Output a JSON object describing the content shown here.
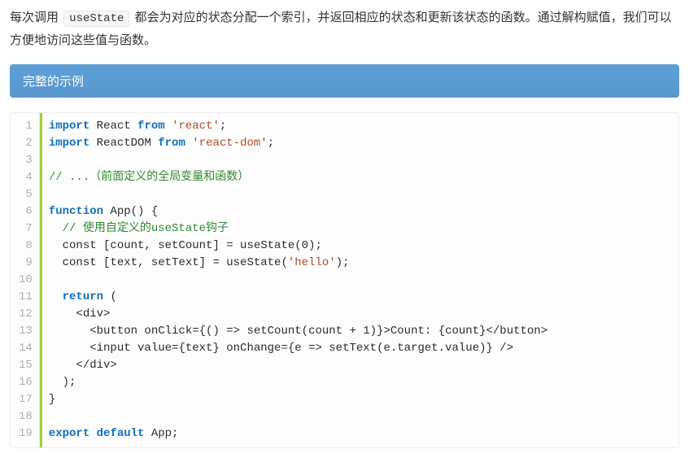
{
  "paragraph": {
    "prefix": "每次调用 ",
    "code": "useState",
    "suffix": " 都会为对应的状态分配一个索引，并返回相应的状态和更新该状态的函数。通过解构赋值，我们可以方便地访问这些值与函数。"
  },
  "callout": {
    "title": "完整的示例"
  },
  "syntax_colors": {
    "keyword": "#0f6fbf",
    "string": "#b04a2b",
    "comment": "#2e8b2e",
    "plain": "#2b2b2b",
    "accent_border": "#9ad03a",
    "callout_bg": "#5a9ed6"
  },
  "code": {
    "lines": [
      {
        "n": 1,
        "t": [
          [
            "kw",
            "import"
          ],
          [
            "p",
            " React "
          ],
          [
            "kw",
            "from"
          ],
          [
            "p",
            " "
          ],
          [
            "s",
            "'react'"
          ],
          [
            "p",
            ";"
          ]
        ]
      },
      {
        "n": 2,
        "t": [
          [
            "kw",
            "import"
          ],
          [
            "p",
            " ReactDOM "
          ],
          [
            "kw",
            "from"
          ],
          [
            "p",
            " "
          ],
          [
            "s",
            "'react-dom'"
          ],
          [
            "p",
            ";"
          ]
        ]
      },
      {
        "n": 3,
        "t": []
      },
      {
        "n": 4,
        "t": [
          [
            "c",
            "// ...（前面定义的全局变量和函数）"
          ]
        ]
      },
      {
        "n": 5,
        "t": []
      },
      {
        "n": 6,
        "t": [
          [
            "kw",
            "function"
          ],
          [
            "p",
            " App() {"
          ]
        ]
      },
      {
        "n": 7,
        "t": [
          [
            "p",
            "  "
          ],
          [
            "c",
            "// 使用自定义的useState钩子"
          ]
        ]
      },
      {
        "n": 8,
        "t": [
          [
            "p",
            "  const [count, setCount] = useState(0);"
          ]
        ]
      },
      {
        "n": 9,
        "t": [
          [
            "p",
            "  const [text, setText] = useState("
          ],
          [
            "s",
            "'hello'"
          ],
          [
            "p",
            ");"
          ]
        ]
      },
      {
        "n": 10,
        "t": []
      },
      {
        "n": 11,
        "t": [
          [
            "p",
            "  "
          ],
          [
            "kw",
            "return"
          ],
          [
            "p",
            " ("
          ]
        ]
      },
      {
        "n": 12,
        "t": [
          [
            "p",
            "    <div>"
          ]
        ]
      },
      {
        "n": 13,
        "t": [
          [
            "p",
            "      <button onClick={() => setCount(count + 1)}>Count: {count}</button>"
          ]
        ]
      },
      {
        "n": 14,
        "t": [
          [
            "p",
            "      <input value={text} onChange={e => setText(e.target.value)} />"
          ]
        ]
      },
      {
        "n": 15,
        "t": [
          [
            "p",
            "    </div>"
          ]
        ]
      },
      {
        "n": 16,
        "t": [
          [
            "p",
            "  );"
          ]
        ]
      },
      {
        "n": 17,
        "t": [
          [
            "p",
            "}"
          ]
        ]
      },
      {
        "n": 18,
        "t": []
      },
      {
        "n": 19,
        "t": [
          [
            "kw",
            "export"
          ],
          [
            "p",
            " "
          ],
          [
            "kw",
            "default"
          ],
          [
            "p",
            " App;"
          ]
        ]
      }
    ]
  }
}
